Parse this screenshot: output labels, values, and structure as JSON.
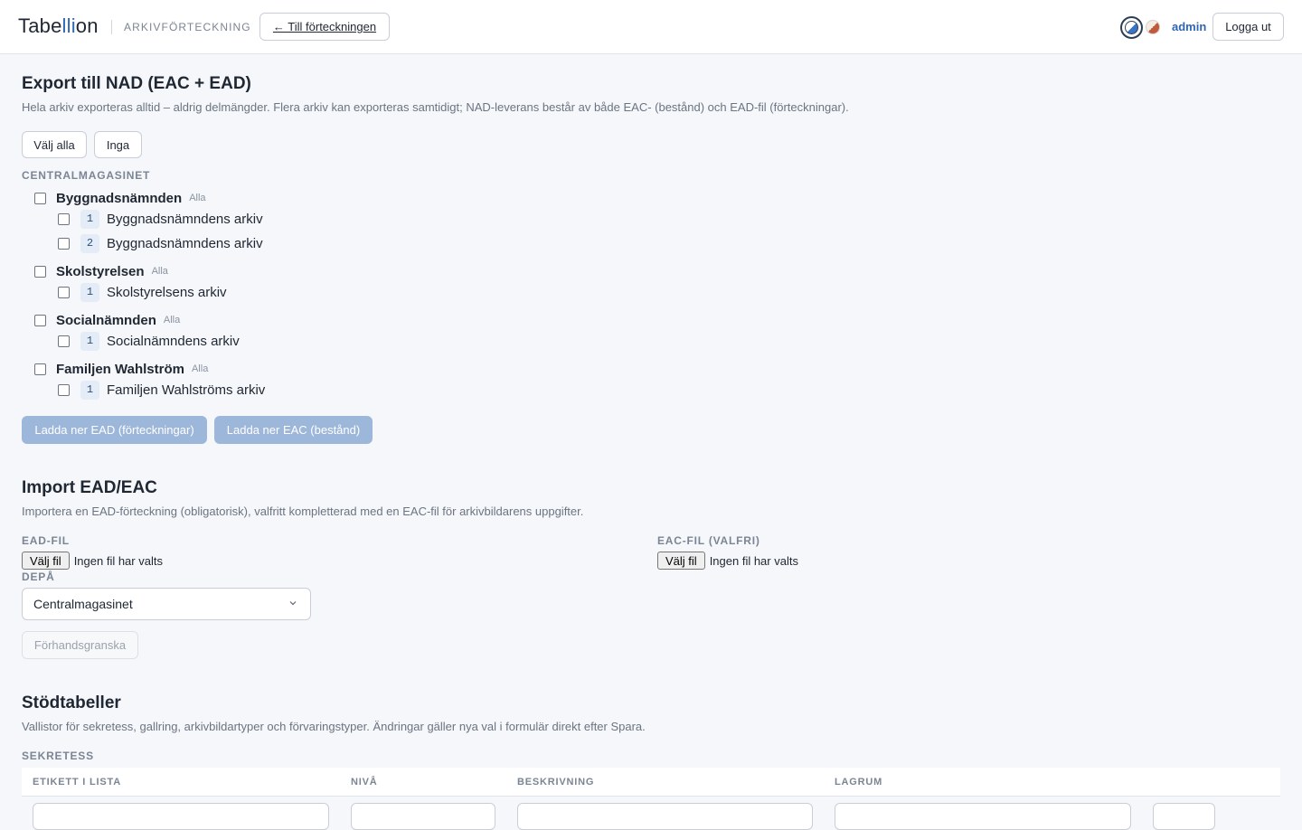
{
  "header": {
    "logo_prefix": "Tabe",
    "logo_accent": "lli",
    "logo_suffix": "on",
    "section": "ARKIVFÖRTECKNING",
    "back_label": "← Till förteckningen",
    "user": "admin",
    "logout_label": "Logga ut"
  },
  "export": {
    "title": "Export till NAD (EAC + EAD)",
    "description": "Hela arkiv exporteras alltid – aldrig delmängder. Flera arkiv kan exporteras samtidigt; NAD-leverans består av både EAC- (bestånd) och EAD-fil (förteckningar).",
    "select_all": "Välj alla",
    "select_none": "Inga",
    "depot": "CENTRALMAGASINET",
    "groups": [
      {
        "name": "Byggnadsnämnden",
        "all": "Alla",
        "items": [
          {
            "num": "1",
            "name": "Byggnadsnämndens arkiv"
          },
          {
            "num": "2",
            "name": "Byggnadsnämndens arkiv"
          }
        ]
      },
      {
        "name": "Skolstyrelsen",
        "all": "Alla",
        "items": [
          {
            "num": "1",
            "name": "Skolstyrelsens arkiv"
          }
        ]
      },
      {
        "name": "Socialnämnden",
        "all": "Alla",
        "items": [
          {
            "num": "1",
            "name": "Socialnämndens arkiv"
          }
        ]
      },
      {
        "name": "Familjen Wahlström",
        "all": "Alla",
        "items": [
          {
            "num": "1",
            "name": "Familjen Wahlströms arkiv"
          }
        ]
      }
    ],
    "download_ead": "Ladda ner EAD (förteckningar)",
    "download_eac": "Ladda ner EAC (bestånd)"
  },
  "import": {
    "title": "Import EAD/EAC",
    "description": "Importera en EAD-förteckning (obligatorisk), valfritt kompletterad med en EAC-fil för arkivbildarens uppgifter.",
    "ead_label": "EAD-FIL",
    "eac_label": "EAC-FIL (VALFRI)",
    "choose_file": "Välj fil",
    "no_file": "Ingen fil har valts",
    "depot_label": "DEPÅ",
    "depot_value": "Centralmagasinet",
    "preview": "Förhandsgranska"
  },
  "support": {
    "title": "Stödtabeller",
    "description": "Vallistor för sekretess, gallring, arkivbildartyper och förvaringstyper. Ändringar gäller nya val i formulär direkt efter Spara.",
    "secrecy_label": "SEKRETESS",
    "columns": [
      "ETIKETT I LISTA",
      "NIVÅ",
      "BESKRIVNING",
      "LAGRUM"
    ]
  }
}
